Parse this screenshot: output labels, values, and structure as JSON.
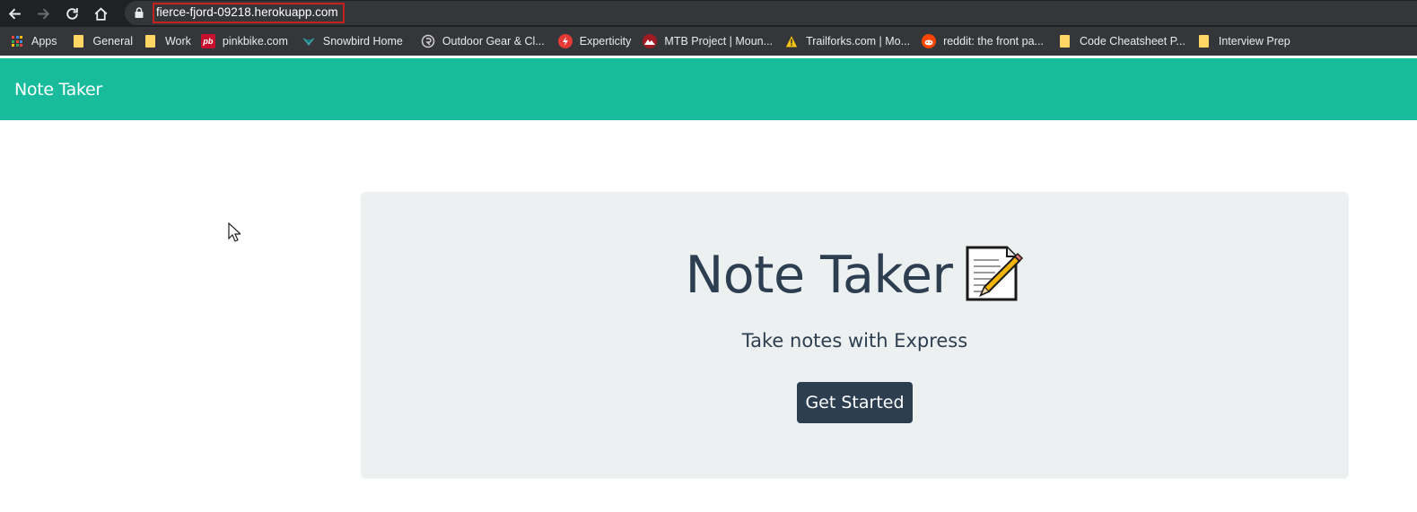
{
  "browser": {
    "url": "fierce-fjord-09218.herokuapp.com",
    "bookmarks": [
      {
        "label": "Apps",
        "icon": "apps-grid-icon"
      },
      {
        "label": "General",
        "icon": "folder-icon"
      },
      {
        "label": "Work",
        "icon": "folder-icon"
      },
      {
        "label": "pinkbike.com",
        "icon": "pinkbike-icon",
        "icon_text": "pb"
      },
      {
        "label": "Snowbird Home",
        "icon": "snowbird-icon"
      },
      {
        "label": "Outdoor Gear & Cl...",
        "icon": "outdoor-gear-icon"
      },
      {
        "label": "Experticity",
        "icon": "experticity-icon"
      },
      {
        "label": "MTB Project | Moun...",
        "icon": "mtb-project-icon"
      },
      {
        "label": "Trailforks.com | Mo...",
        "icon": "trailforks-icon"
      },
      {
        "label": "reddit: the front pa...",
        "icon": "reddit-icon"
      },
      {
        "label": "Code Cheatsheet P...",
        "icon": "folder-icon"
      },
      {
        "label": "Interview Prep",
        "icon": "folder-icon"
      }
    ]
  },
  "navbar": {
    "brand": "Note Taker",
    "color": "#18bc9c"
  },
  "jumbotron": {
    "title": "Note Taker",
    "title_icon": "memo-icon",
    "subtitle": "Take notes with Express",
    "button_label": "Get Started",
    "background": "#ecf0f1",
    "button_color": "#2c3e50"
  }
}
